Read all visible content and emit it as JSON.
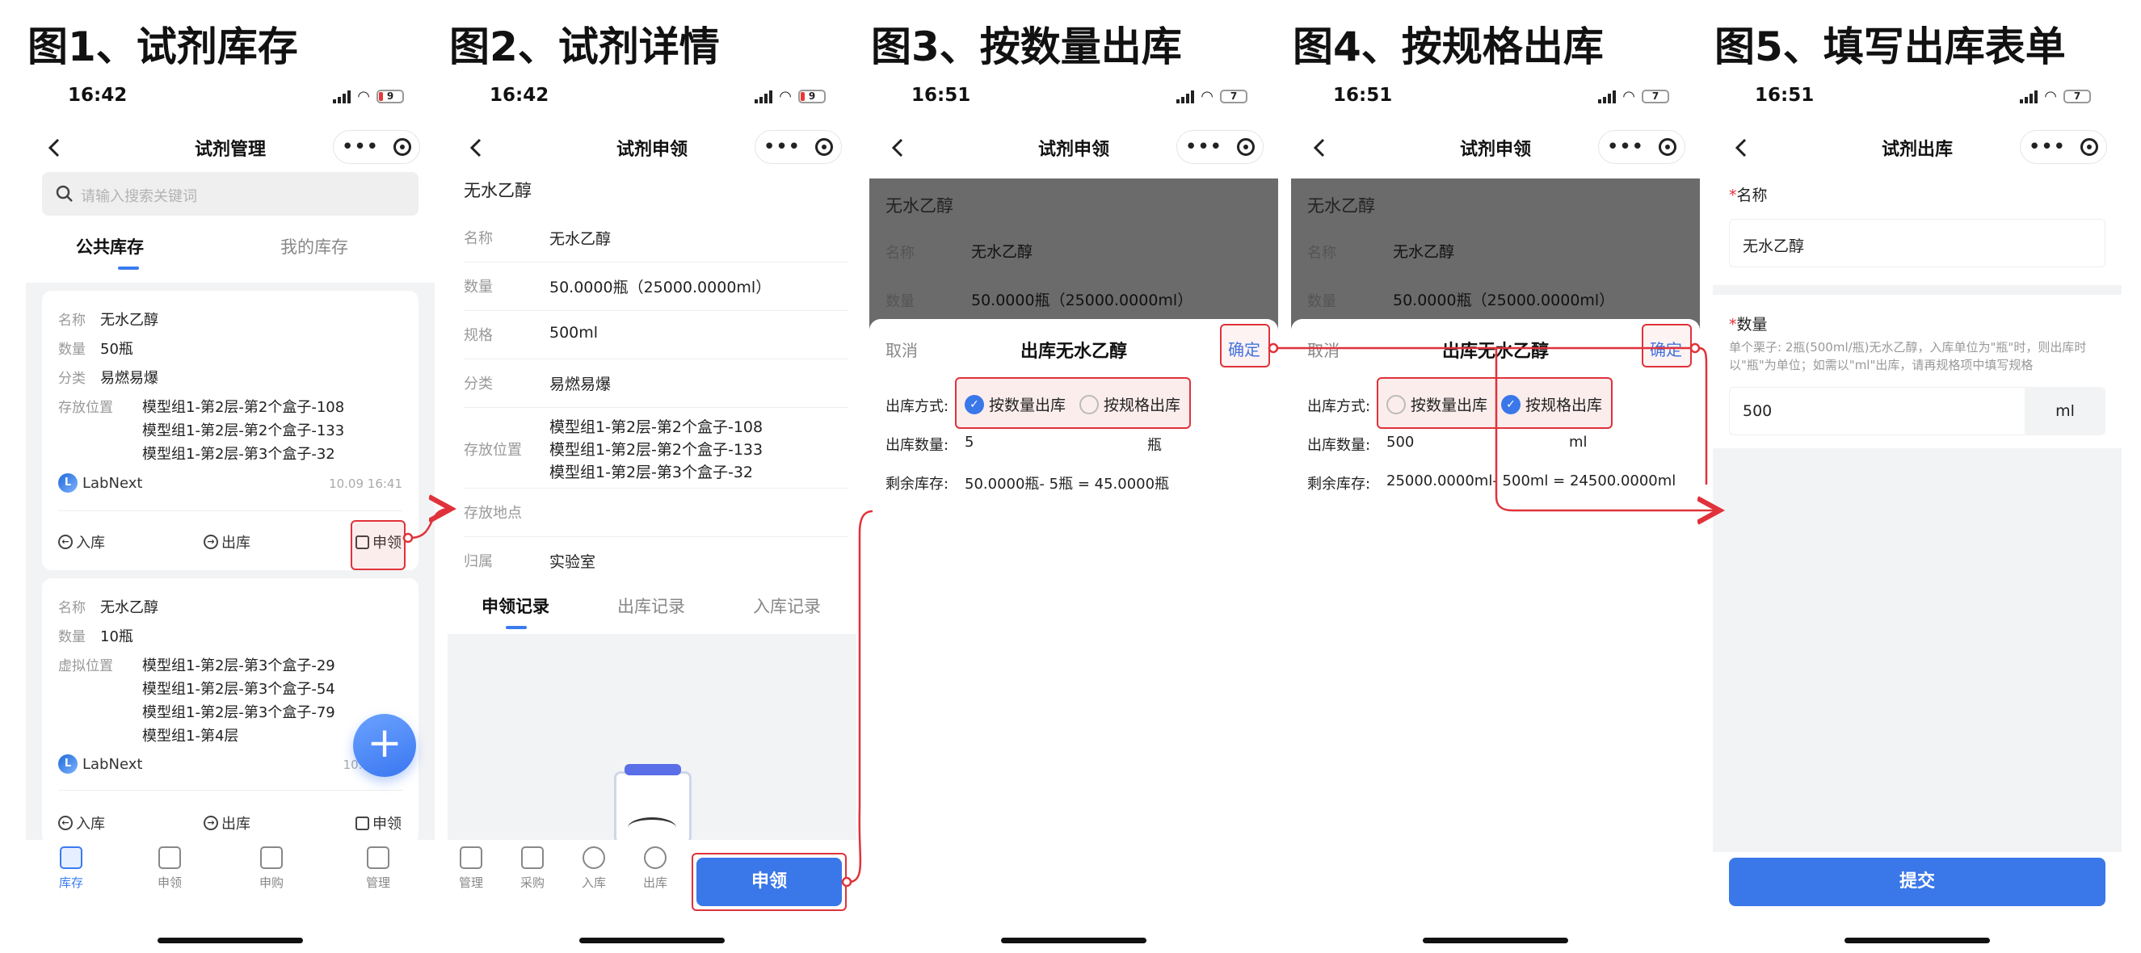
{
  "figures": [
    "图1、试剂库存",
    "图2、试剂详情",
    "图3、按数量出库",
    "图4、按规格出库",
    "图5、填写出库表单"
  ],
  "status": {
    "s1": {
      "time": "16:42",
      "battery": "9"
    },
    "s2": {
      "time": "16:42",
      "battery": "9"
    },
    "s3": {
      "time": "16:51",
      "battery": "7"
    },
    "s4": {
      "time": "16:51",
      "battery": "7"
    },
    "s5": {
      "time": "16:51",
      "battery": "7"
    }
  },
  "nav": {
    "t1": "试剂管理",
    "t2": "试剂申领",
    "t3": "试剂申领",
    "t4": "试剂申领",
    "t5": "试剂出库"
  },
  "inventory": {
    "search_placeholder": "请输入搜索关键词",
    "tab_public": "公共库存",
    "tab_mine": "我的库存",
    "cards": [
      {
        "name_k": "名称",
        "name_v": "无水乙醇",
        "qty_k": "数量",
        "qty_v": "50瓶",
        "cat_k": "分类",
        "cat_v": "易燃易爆",
        "loc_k": "存放位置",
        "locs": [
          "模型组1-第2层-第2个盒子-108",
          "模型组1-第2层-第2个盒子-133",
          "模型组1-第2层-第3个盒子-32"
        ],
        "brand": "LabNext",
        "time": "10.09 16:41"
      },
      {
        "name_k": "名称",
        "name_v": "无水乙醇",
        "qty_k": "数量",
        "qty_v": "10瓶",
        "loc_k": "虚拟位置",
        "locs": [
          "模型组1-第2层-第3个盒子-29",
          "模型组1-第2层-第3个盒子-54",
          "模型组1-第2层-第3个盒子-79",
          "模型组1-第4层"
        ],
        "brand": "LabNext",
        "time": "10.0"
      }
    ],
    "actions": {
      "in": "入库",
      "out": "出库",
      "apply": "申领"
    },
    "fab": "+"
  },
  "tabbar1": [
    {
      "label": "库存",
      "active": true
    },
    {
      "label": "申领",
      "active": false
    },
    {
      "label": "申购",
      "active": false
    },
    {
      "label": "管理",
      "active": false
    }
  ],
  "detail": {
    "title": "无水乙醇",
    "rows": [
      {
        "k": "名称",
        "v": "无水乙醇"
      },
      {
        "k": "数量",
        "v": "50.0000瓶（25000.0000ml）"
      },
      {
        "k": "规格",
        "v": "500ml"
      },
      {
        "k": "分类",
        "v": "易燃易爆"
      }
    ],
    "loc_k": "存放位置",
    "locs": [
      "模型组1-第2层-第2个盒子-108",
      "模型组1-第2层-第2个盒子-133",
      "模型组1-第2层-第3个盒子-32"
    ],
    "site_k": "存放地点",
    "site_v": "",
    "owner_k": "归属",
    "owner_v": "实验室",
    "tabs": [
      "申领记录",
      "出库记录",
      "入库记录"
    ],
    "bottom": [
      "管理",
      "采购",
      "入库",
      "出库"
    ],
    "apply_btn": "申领"
  },
  "sheet3": {
    "cancel": "取消",
    "title": "出库无水乙醇",
    "confirm": "确定",
    "mode_k": "出库方式:",
    "opt_qty": "按数量出库",
    "opt_spec": "按规格出库",
    "qty_k": "出库数量:",
    "qty_v": "5",
    "qty_unit": "瓶",
    "rem_k": "剩余库存:",
    "rem_v": "50.0000瓶- 5瓶 = 45.0000瓶",
    "selected": "qty"
  },
  "sheet4": {
    "cancel": "取消",
    "title": "出库无水乙醇",
    "confirm": "确定",
    "mode_k": "出库方式:",
    "opt_qty": "按数量出库",
    "opt_spec": "按规格出库",
    "qty_k": "出库数量:",
    "qty_v": "500",
    "qty_unit": "ml",
    "rem_k": "剩余库存:",
    "rem_v": "25000.0000ml- 500ml = 24500.0000ml",
    "selected": "spec"
  },
  "bg_detail": {
    "title": "无水乙醇",
    "name_k": "名称",
    "name_v": "无水乙醇",
    "qty_k": "数量",
    "qty_v": "50.0000瓶（25000.0000ml）"
  },
  "form5": {
    "name_label": "名称",
    "name_value": "无水乙醇",
    "qty_label": "数量",
    "hint": "单个栗子: 2瓶(500ml/瓶)无水乙醇，入库单位为\"瓶\"时，则出库时以\"瓶\"为单位；如需以\"ml\"出库，请再规格项中填写规格",
    "qty_value": "500",
    "unit": "ml",
    "submit": "提交"
  },
  "colors": {
    "accent": "#3a77e8",
    "highlight": "#e0323a"
  }
}
